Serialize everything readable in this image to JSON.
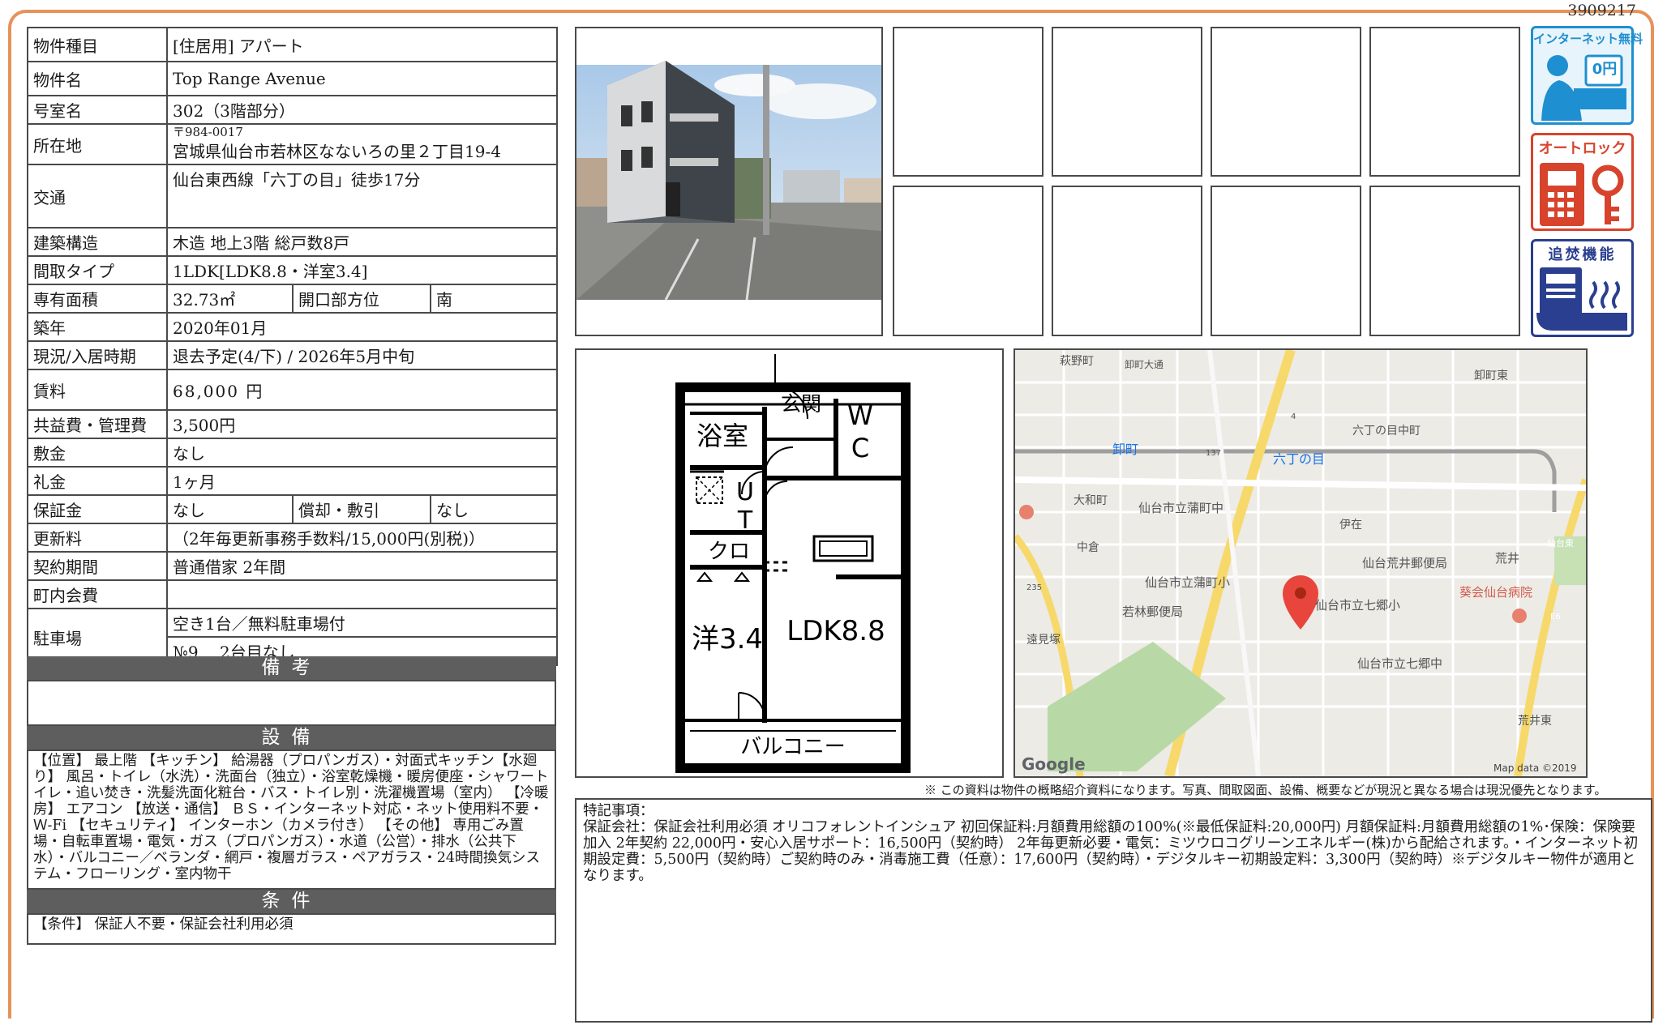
{
  "doc_id": "3909217",
  "property": {
    "type_label": "物件種目",
    "type_value": "[住居用] アパート",
    "name_label": "物件名",
    "name_value": "Top Range Avenue",
    "room_label": "号室名",
    "room_value": "302（3階部分）",
    "address_label": "所在地",
    "zip": "〒984-0017",
    "address_value": "宮城県仙台市若林区なないろの里２丁目19-4",
    "access_label": "交通",
    "access_value": "仙台東西線「六丁の目」徒歩17分",
    "structure_label": "建築構造",
    "structure_value": "木造 地上3階 総戸数8戸",
    "layout_label": "間取タイプ",
    "layout_value": "1LDK[LDK8.8・洋室3.4]",
    "area_label": "専有面積",
    "area_value": "32.73㎡",
    "direction_label": "開口部方位",
    "direction_value": "南",
    "built_label": "築年",
    "built_value": "2020年01月",
    "status_label": "現況/入居時期",
    "status_value": "退去予定(4/下) / 2026年5月中旬",
    "rent_label": "賃料",
    "rent_value": "68,000 円",
    "fee_label": "共益費・管理費",
    "fee_value": "3,500円",
    "deposit_label": "敷金",
    "deposit_value": "なし",
    "key_money_label": "礼金",
    "key_money_value": "1ヶ月",
    "guarantee_label": "保証金",
    "guarantee_value": "なし",
    "amort_label": "償却・敷引",
    "amort_value": "なし",
    "renewal_label": "更新料",
    "renewal_value": "（2年毎更新事務手数料/15,000円(別税)）",
    "contract_label": "契約期間",
    "contract_value": "普通借家 2年間",
    "community_label": "町内会費",
    "community_value": "",
    "parking_label": "駐車場",
    "parking_value1": "空き1台／無料駐車場付",
    "parking_value2": "№9　 2台目なし"
  },
  "sections": {
    "remarks_title": "備考",
    "equipment_title": "設備",
    "equipment_text": "【位置】 最上階 【キッチン】 給湯器（プロパンガス）・対面式キッチン【水廻り】 風呂・トイレ（水洗）・洗面台（独立）・浴室乾燥機・暖房便座・シャワートイレ・追い焚き・洗髪洗面化粧台・バス・トイレ別・洗濯機置場（室内） 【冷暖房】 エアコン 【放送・通信】 ＢＳ・インターネット対応・ネット使用料不要・Ｗ-Fi 【セキュリティ】 インターホン（カメラ付き） 【その他】 専用ごみ置場・自転車置場・電気・ガス（プロパンガス）・水道（公営）・排水（公共下水）・バルコニー／ベランダ・網戸・複層ガラス・ペアガラス・24時間換気システム・フローリング・室内物干",
    "conditions_title": "条件",
    "conditions_text": "【条件】 保証人不要・保証会社利用必須"
  },
  "icons": {
    "internet_label": "インターネット無料",
    "internet_price": "0円",
    "autolock_label": "オートロック",
    "reheat_label": "追焚機能"
  },
  "floorplan": {
    "bath": "浴室",
    "entrance": "玄関",
    "wc1": "W",
    "wc2": "C",
    "ut1": "U",
    "ut2": "T",
    "closet": "クロ",
    "western": "洋3.4",
    "ldk": "LDK8.8",
    "balcony": "バルコニー"
  },
  "map": {
    "labels": [
      "萩野町",
      "卸町大通",
      "卸町東",
      "六丁の目中町",
      "卸町",
      "六丁の目",
      "137",
      "4",
      "大和町",
      "仙台市立蒲町中",
      "伊在",
      "中倉",
      "仙台荒井郵便局",
      "荒井",
      "仙台東",
      "235",
      "仙台市立蒲町小",
      "若林郵便局",
      "仙台市立七郷小",
      "葵会仙台病院",
      "E6",
      "遠見塚",
      "仙台市立七郷中",
      "荒井東",
      "Google",
      "Map data ©2019"
    ]
  },
  "disclaimer": "※ この資料は物件の概略紹介資料になります。写真、間取図面、設備、概要などが現況と異なる場合は現況優先となります。",
  "special": {
    "title": "特記事項：",
    "text": "保証会社：保証会社利用必須 オリコフォレントインシュア 初回保証料:月額費用総額の100%(※最低保証料:20,000円) 月額保証料:月額費用総額の1%･保険：保険要加入 2年契約 22,000円・安心入居サポート：16,500円（契約時） 2年毎更新必要・電気：ミツウロコグリーンエネルギー(株)から配給されます。・インターネット初期設定費：5,500円（契約時）ご契約時のみ・消毒施工費（任意）：17,600円（契約時）・デジタルキー初期設定料：3,300円（契約時）※デジタルキー物件が適用となります。"
  },
  "colors": {
    "frame": "#e6925a",
    "section_bar": "#5e5e5e",
    "icon_blue": "#1e8fd0",
    "icon_red": "#d8432c",
    "icon_navy": "#2a3f8f"
  }
}
